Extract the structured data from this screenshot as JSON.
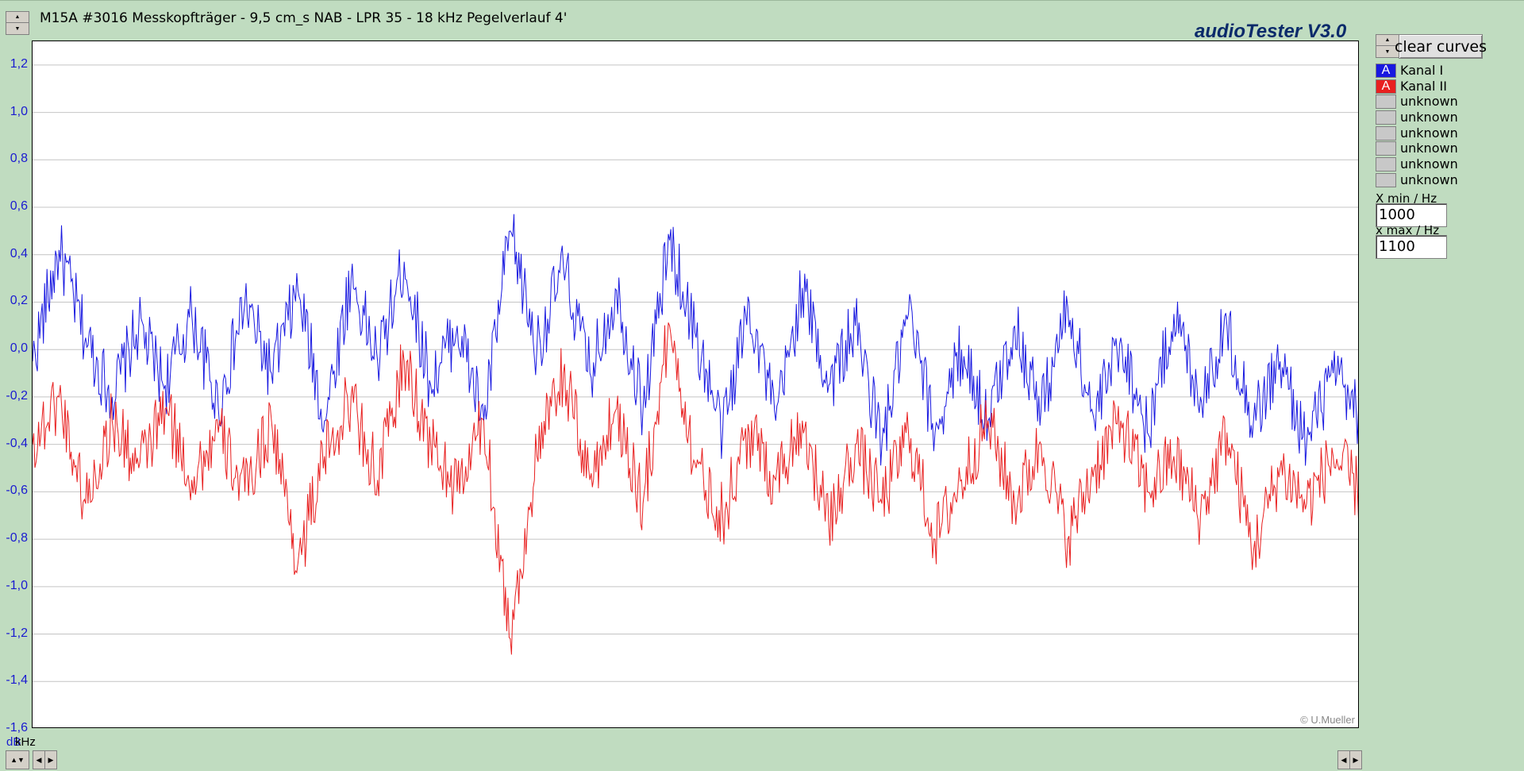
{
  "window": {
    "title": "M15A  #3016 Messkopfträger - 9,5 cm_s NAB - LPR 35 - 18 kHz Pegelverlauf 4'",
    "app_title": "audioTester  V3.0",
    "copyright": "© U.Mueller"
  },
  "controls": {
    "clear_label": "clear curves",
    "xmin_label": "X min / Hz",
    "xmin_value": "1000",
    "xmax_label": "x max / Hz",
    "xmax_value": "1100",
    "y_unit": "dB",
    "x_unit": "kHz"
  },
  "legend": [
    {
      "badge": "A",
      "label": "Kanal I",
      "color": "#1818e0"
    },
    {
      "badge": "A",
      "label": "Kanal II",
      "color": "#e82020"
    },
    {
      "badge": "",
      "label": "unknown",
      "color": ""
    },
    {
      "badge": "",
      "label": "unknown",
      "color": ""
    },
    {
      "badge": "",
      "label": "unknown",
      "color": ""
    },
    {
      "badge": "",
      "label": "unknown",
      "color": ""
    },
    {
      "badge": "",
      "label": "unknown",
      "color": ""
    },
    {
      "badge": "",
      "label": "unknown",
      "color": ""
    }
  ],
  "chart_data": {
    "type": "line",
    "ylabel": "dB",
    "xlabel": "kHz",
    "ylim": [
      -1.6,
      1.3
    ],
    "xlim": [
      1000,
      1100
    ],
    "yticks": [
      "1,2",
      "1,0",
      "0,8",
      "0,6",
      "0,4",
      "0,2",
      "0,0",
      "-0,2",
      "-0,4",
      "-0,6",
      "-0,8",
      "-1,0",
      "-1,2",
      "-1,4",
      "-1,6"
    ],
    "grid": true,
    "series": [
      {
        "name": "Kanal I",
        "color": "#1818e0",
        "x": [
          1000,
          2,
          4,
          6,
          8,
          10,
          12,
          14,
          16,
          18,
          20,
          22,
          24,
          26,
          28,
          30,
          32,
          34,
          36,
          38,
          40,
          42,
          44,
          46,
          48,
          50,
          52,
          54,
          56,
          58,
          60,
          62,
          64,
          66,
          68,
          70,
          72,
          74,
          76,
          78,
          80,
          82,
          84,
          86,
          88,
          90,
          92,
          94,
          96,
          98,
          1100
        ],
        "values": [
          -0.05,
          0.42,
          0.05,
          -0.2,
          0.1,
          -0.15,
          0.15,
          -0.25,
          0.2,
          -0.1,
          0.25,
          -0.3,
          0.3,
          -0.05,
          0.37,
          -0.15,
          0.1,
          -0.3,
          0.5,
          0.0,
          0.35,
          -0.1,
          0.25,
          -0.25,
          0.46,
          0.05,
          -0.35,
          0.2,
          -0.3,
          0.26,
          -0.15,
          0.1,
          -0.4,
          0.15,
          -0.35,
          0.0,
          -0.3,
          0.1,
          -0.25,
          0.18,
          -0.3,
          0.05,
          -0.35,
          0.15,
          -0.2,
          0.1,
          -0.3,
          -0.05,
          -0.4,
          -0.1,
          -0.3
        ]
      },
      {
        "name": "Kanal II",
        "color": "#e82020",
        "x": [
          1000,
          2,
          4,
          6,
          8,
          10,
          12,
          14,
          16,
          18,
          20,
          22,
          24,
          26,
          28,
          30,
          32,
          34,
          36,
          38,
          40,
          42,
          44,
          46,
          48,
          50,
          52,
          54,
          56,
          58,
          60,
          62,
          64,
          66,
          68,
          70,
          72,
          74,
          76,
          78,
          80,
          82,
          84,
          86,
          88,
          90,
          92,
          94,
          96,
          98,
          1100
        ],
        "values": [
          -0.4,
          -0.2,
          -0.65,
          -0.3,
          -0.5,
          -0.25,
          -0.55,
          -0.35,
          -0.6,
          -0.3,
          -0.9,
          -0.45,
          -0.2,
          -0.55,
          -0.05,
          -0.4,
          -0.6,
          -0.3,
          -1.22,
          -0.45,
          -0.1,
          -0.55,
          -0.25,
          -0.65,
          0.1,
          -0.5,
          -0.7,
          -0.35,
          -0.55,
          -0.3,
          -0.75,
          -0.4,
          -0.65,
          -0.35,
          -0.8,
          -0.55,
          -0.3,
          -0.65,
          -0.4,
          -0.8,
          -0.5,
          -0.3,
          -0.6,
          -0.45,
          -0.7,
          -0.35,
          -0.85,
          -0.5,
          -0.65,
          -0.45,
          -0.6
        ]
      }
    ]
  }
}
